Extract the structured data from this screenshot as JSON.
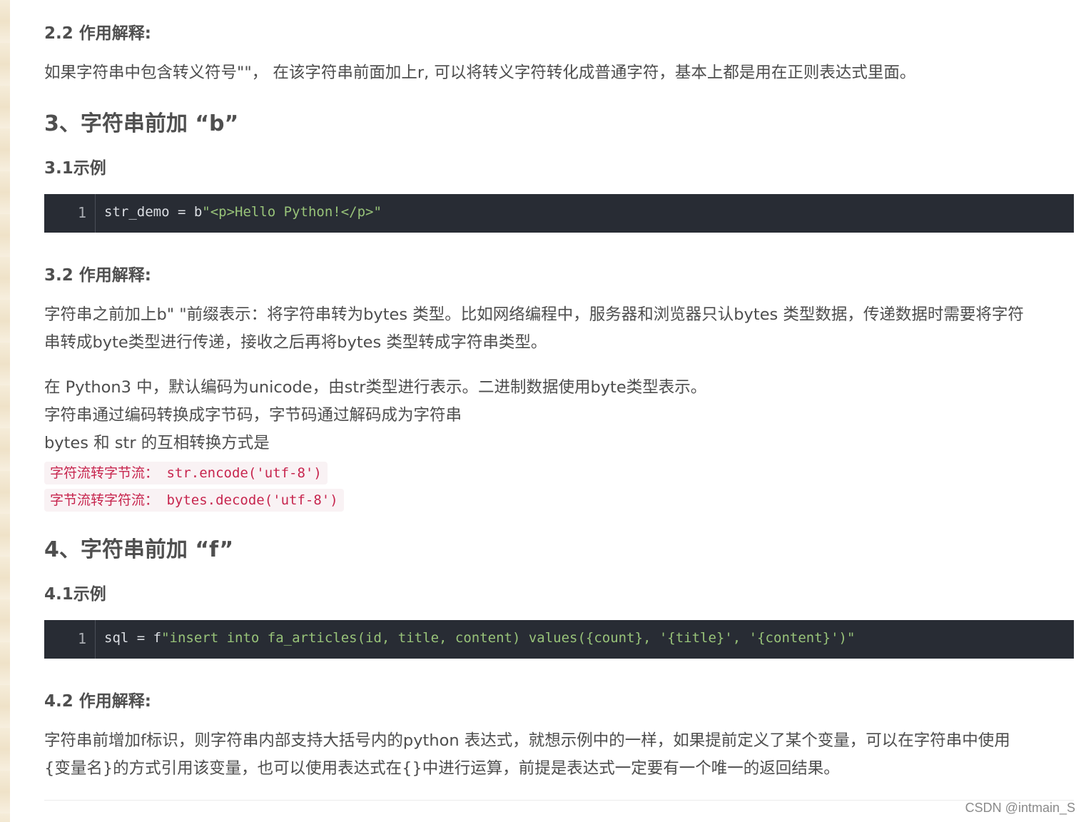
{
  "section_2_2": {
    "heading": "2.2 作用解释:",
    "paragraph": "如果字符串中包含转义符号\"\"， 在该字符串前面加上r, 可以将转义字符转化成普通字符，基本上都是用在正则表达式里面。"
  },
  "section_3": {
    "heading": "3、字符串前加 “b”",
    "example_heading": "3.1示例",
    "code": {
      "line_number": "1",
      "plain": "str_demo = b",
      "string": "\"<p>Hello Python!</p>\""
    },
    "explain_heading": "3.2 作用解释:",
    "paragraph1_line1": "字符串之前加上b\" \"前缀表示：将字符串转为bytes 类型。比如网络编程中，服务器和浏览器只认bytes 类型数据，传递数据时需要将字符",
    "paragraph1_line2": "串转成byte类型进行传递，接收之后再将bytes 类型转成字符串类型。",
    "paragraph2_line1": "在 Python3 中，默认编码为unicode，由str类型进行表示。二进制数据使用byte类型表示。",
    "paragraph2_line2": "字符串通过编码转换成字节码，字节码通过解码成为字符串",
    "paragraph2_line3": "bytes 和 str 的互相转换方式是",
    "inline_code1": "字符流转字节流： str.encode('utf-8')",
    "inline_code2": "字节流转字符流： bytes.decode('utf-8')"
  },
  "section_4": {
    "heading": "4、字符串前加 “f”",
    "example_heading": "4.1示例",
    "code": {
      "line_number": "1",
      "plain": "sql = f",
      "string": "\"insert into fa_articles(id, title, content) values({count}, '{title}', '{content}')\""
    },
    "explain_heading": "4.2 作用解释:",
    "paragraph_line1": "字符串前增加f标识，则字符串内部支持大括号内的python 表达式，就想示例中的一样，如果提前定义了某个变量，可以在字符串中使用",
    "paragraph_line2": "{变量名}的方式引用该变量，也可以使用表达式在{}中进行运算，前提是表达式一定要有一个唯一的返回结果。"
  },
  "watermark": "CSDN @intmain_S",
  "colors": {
    "code_bg": "#282c34",
    "code_string": "#98c379",
    "inline_code_bg": "#f9f2f4",
    "inline_code_text": "#c7254e"
  }
}
